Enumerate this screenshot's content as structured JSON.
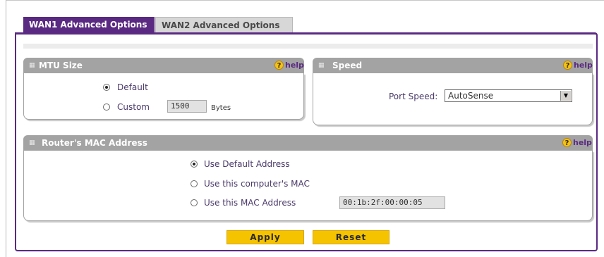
{
  "tabs": [
    {
      "label": "WAN1 Advanced Options",
      "active": true
    },
    {
      "label": "WAN2 Advanced Options",
      "active": false
    }
  ],
  "mtu": {
    "title": "MTU Size",
    "help": "help",
    "options": [
      {
        "label": "Default",
        "checked": true
      },
      {
        "label": "Custom",
        "checked": false
      }
    ],
    "custom_value": "1500",
    "unit": "Bytes"
  },
  "speed": {
    "title": "Speed",
    "help": "help",
    "port_label": "Port Speed:",
    "port_value": "AutoSense"
  },
  "mac": {
    "title": "Router's MAC Address",
    "help": "help",
    "options": [
      {
        "label": "Use Default Address",
        "checked": true
      },
      {
        "label": "Use this computer's MAC",
        "checked": false
      },
      {
        "label": "Use this MAC Address",
        "checked": false
      }
    ],
    "mac_value": "00:1b:2f:00:00:05"
  },
  "buttons": {
    "apply": "Apply",
    "reset": "Reset"
  },
  "colors": {
    "accent": "#5a2a82",
    "header_gray": "#a3a3a3",
    "button": "#f5c300",
    "help_icon": "#f3c217"
  }
}
